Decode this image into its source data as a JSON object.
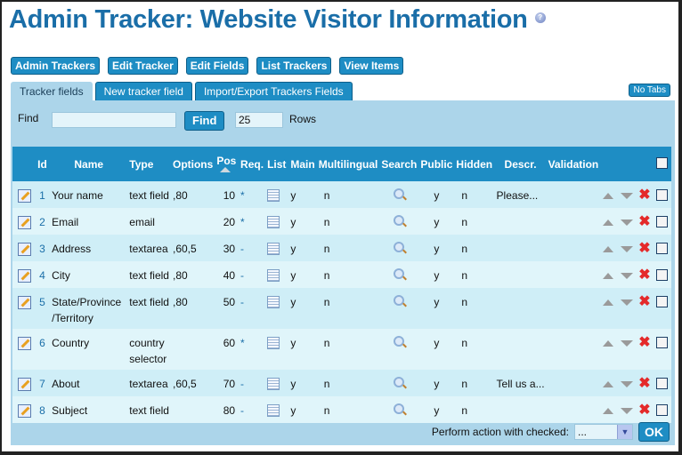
{
  "page": {
    "title": "Admin Tracker: Website Visitor Information",
    "help_icon": "help-icon"
  },
  "nav_buttons": [
    {
      "label": "Admin Trackers"
    },
    {
      "label": "Edit Tracker"
    },
    {
      "label": "Edit Fields"
    },
    {
      "label": "List Trackers"
    },
    {
      "label": "View Items"
    }
  ],
  "tabs": [
    {
      "label": "Tracker fields",
      "active": true
    },
    {
      "label": "New tracker field",
      "active": false
    },
    {
      "label": "Import/Export Trackers Fields",
      "active": false
    }
  ],
  "no_tabs_label": "No Tabs",
  "find": {
    "label": "Find",
    "value": "",
    "button": "Find",
    "rows_value": "25",
    "rows_label": "Rows"
  },
  "table": {
    "headers": {
      "id": "Id",
      "name": "Name",
      "type": "Type",
      "options": "Options",
      "pos": "Pos",
      "req": "Req.",
      "list": "List",
      "main": "Main",
      "multilingual": "Multilingual",
      "search": "Search",
      "public": "Public",
      "hidden": "Hidden",
      "descr": "Descr.",
      "validation": "Validation"
    },
    "rows": [
      {
        "id": "1",
        "name": "Your name",
        "name2": "",
        "type": "text field",
        "type2": "",
        "options": ",80",
        "pos": "10",
        "req": "*",
        "main": "y",
        "multilingual": "n",
        "public": "y",
        "hidden": "n",
        "descr": "Please..."
      },
      {
        "id": "2",
        "name": "Email",
        "name2": "",
        "type": "email",
        "type2": "",
        "options": "",
        "pos": "20",
        "req": "*",
        "main": "y",
        "multilingual": "n",
        "public": "y",
        "hidden": "n",
        "descr": ""
      },
      {
        "id": "3",
        "name": "Address",
        "name2": "",
        "type": "textarea",
        "type2": "",
        "options": ",60,5",
        "pos": "30",
        "req": "-",
        "main": "y",
        "multilingual": "n",
        "public": "y",
        "hidden": "n",
        "descr": ""
      },
      {
        "id": "4",
        "name": "City",
        "name2": "",
        "type": "text field",
        "type2": "",
        "options": ",80",
        "pos": "40",
        "req": "-",
        "main": "y",
        "multilingual": "n",
        "public": "y",
        "hidden": "n",
        "descr": ""
      },
      {
        "id": "5",
        "name": "State/Province",
        "name2": "/Territory",
        "type": "text field",
        "type2": "",
        "options": ",80",
        "pos": "50",
        "req": "-",
        "main": "y",
        "multilingual": "n",
        "public": "y",
        "hidden": "n",
        "descr": ""
      },
      {
        "id": "6",
        "name": "Country",
        "name2": "",
        "type": "country",
        "type2": "selector",
        "options": "",
        "pos": "60",
        "req": "*",
        "main": "y",
        "multilingual": "n",
        "public": "y",
        "hidden": "n",
        "descr": ""
      },
      {
        "id": "7",
        "name": "About",
        "name2": "",
        "type": "textarea",
        "type2": "",
        "options": ",60,5",
        "pos": "70",
        "req": "-",
        "main": "y",
        "multilingual": "n",
        "public": "y",
        "hidden": "n",
        "descr": "Tell us a..."
      },
      {
        "id": "8",
        "name": "Subject",
        "name2": "",
        "type": "text field",
        "type2": "",
        "options": "",
        "pos": "80",
        "req": "-",
        "main": "y",
        "multilingual": "n",
        "public": "y",
        "hidden": "n",
        "descr": ""
      }
    ]
  },
  "footer": {
    "perform_label": "Perform action with checked:",
    "action_value": "...",
    "ok_label": "OK"
  },
  "colors": {
    "accent": "#1e8dc4",
    "panel": "#acd5ea",
    "title": "#1a6ea8",
    "delete": "#e42a2a"
  }
}
